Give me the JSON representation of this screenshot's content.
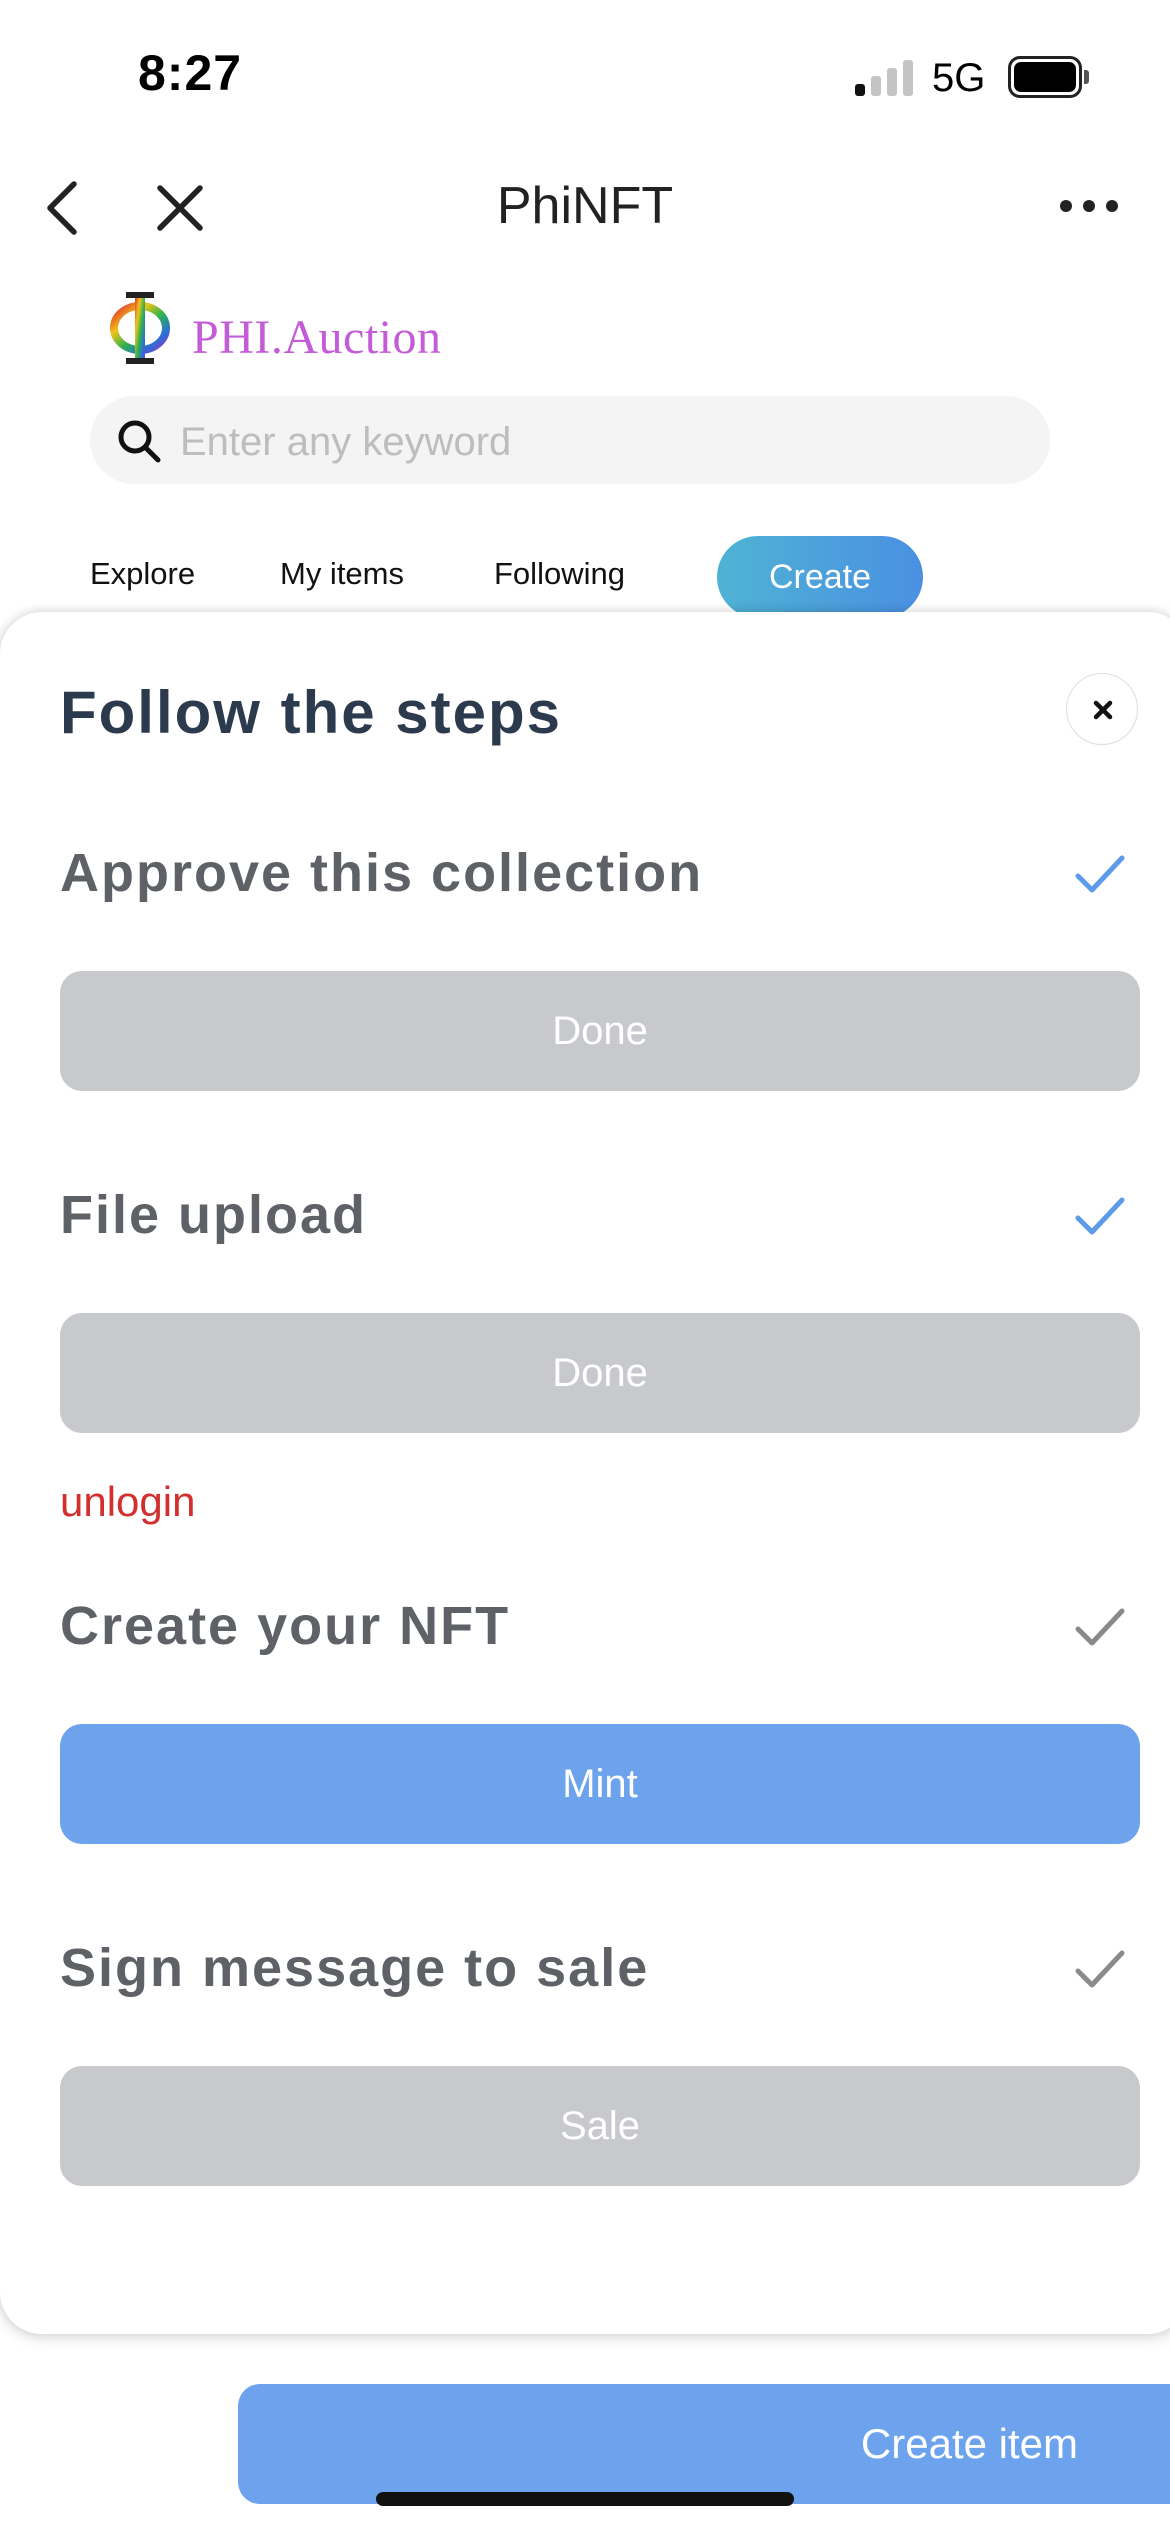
{
  "status_bar": {
    "time": "8:27",
    "network": "5G"
  },
  "nav": {
    "title": "PhiNFT"
  },
  "brand": {
    "logo_text": "PHI.Auction",
    "logo_color": "#c45bd8"
  },
  "search": {
    "placeholder": "Enter any keyword",
    "value": ""
  },
  "tabs": [
    {
      "label": "Explore"
    },
    {
      "label": "My items"
    },
    {
      "label": "Following"
    },
    {
      "label": "Create",
      "active": true
    }
  ],
  "modal": {
    "title": "Follow the steps",
    "steps": [
      {
        "label": "Approve this collection",
        "checked": true,
        "check_color": "#5b9bea",
        "button": "Done",
        "button_state": "disabled"
      },
      {
        "label": "File upload",
        "checked": true,
        "check_color": "#5b9bea",
        "button": "Done",
        "button_state": "disabled"
      },
      {
        "label": "Create your NFT",
        "checked": false,
        "check_color": "#8a8a8a",
        "button": "Mint",
        "button_state": "active"
      },
      {
        "label": "Sign message to sale",
        "checked": false,
        "check_color": "#8a8a8a",
        "button": "Sale",
        "button_state": "disabled"
      }
    ],
    "error": "unlogin"
  },
  "bottom": {
    "create_item_label": "Create item"
  },
  "colors": {
    "accent": "#6ca3ec",
    "disabled": "#c8c9cc",
    "error": "#d32f2f",
    "heading": "#2c3a4d"
  }
}
